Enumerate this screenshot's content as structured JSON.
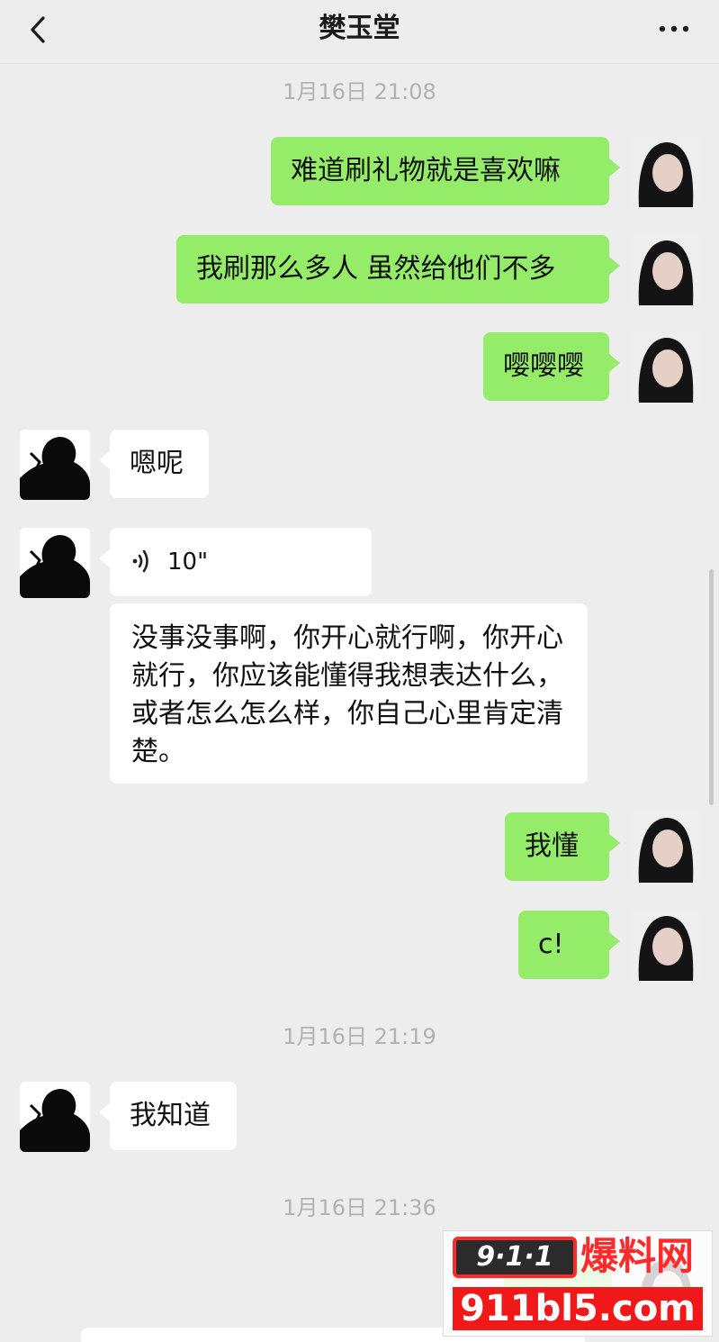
{
  "header": {
    "title": "樊玉堂"
  },
  "timestamps": [
    "1月16日 21:08",
    "1月16日 21:19",
    "1月16日 21:36"
  ],
  "messages": {
    "m1": "难道刷礼物就是喜欢嘛",
    "m2": "我刷那么多人 虽然给他们不多",
    "m3": "嘤嘤嘤",
    "m4": "嗯呢",
    "m5_voice": "10\"",
    "m6": "没事没事啊，你开心就行啊，你开心就行，你应该能懂得我想表达什么，或者怎么怎么样，你自己心里肯定清楚。",
    "m7": "我懂",
    "m8": "c!",
    "m9": "我知道"
  },
  "watermark": {
    "logo": "9·1·1",
    "name": "爆料网",
    "url": "911bl5.com"
  },
  "colors": {
    "my_bubble": "#95ec69",
    "their_bubble": "#ffffff",
    "background": "#ededed"
  }
}
